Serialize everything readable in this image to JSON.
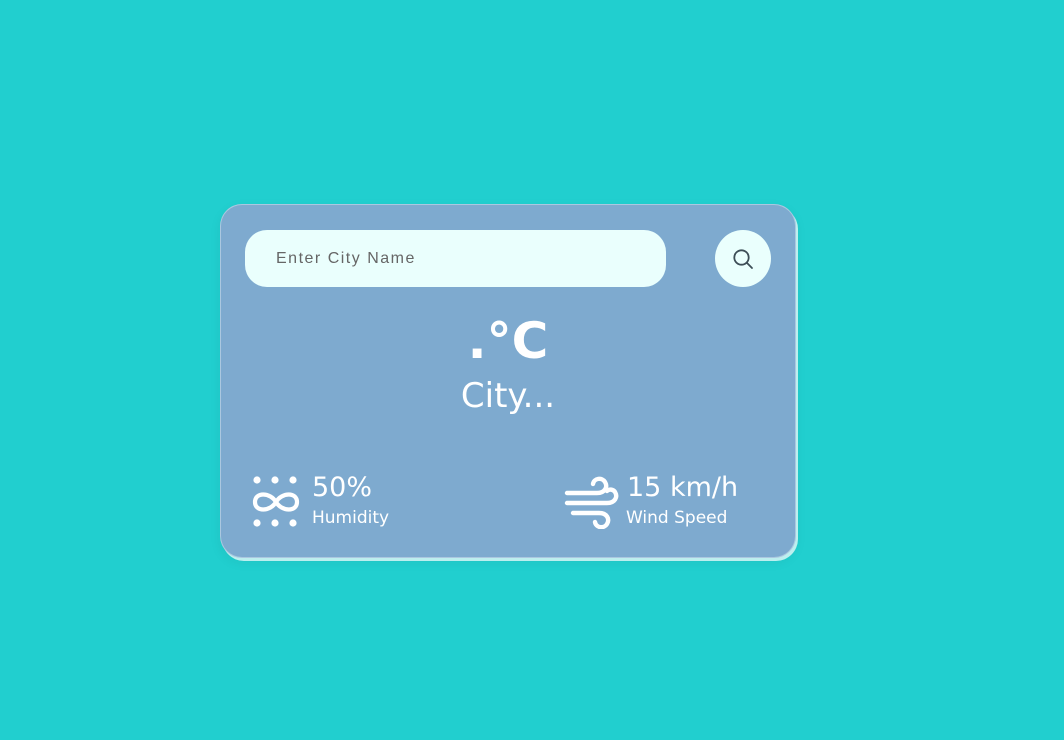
{
  "search": {
    "placeholder": "Enter City Name",
    "value": "",
    "button_icon": "search-icon"
  },
  "weather": {
    "temperature": ".°C",
    "city": "City..."
  },
  "stats": {
    "humidity": {
      "icon": "humidity-icon",
      "value": "50%",
      "label": "Humidity"
    },
    "wind": {
      "icon": "wind-icon",
      "value": "15 km/h",
      "label": "Wind Speed"
    }
  },
  "colors": {
    "background": "#21cfcf",
    "card": "#7eaacf",
    "input": "#eafffd",
    "text": "#ffffff"
  }
}
